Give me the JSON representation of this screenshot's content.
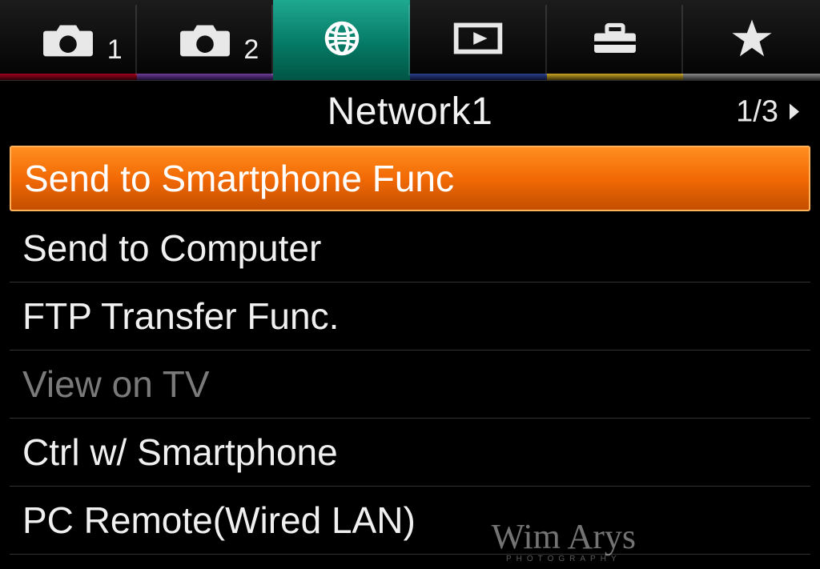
{
  "tabs": [
    {
      "name": "camera-1-tab",
      "icon": "camera-icon",
      "badge": "1",
      "underline": "red",
      "active": false
    },
    {
      "name": "camera-2-tab",
      "icon": "camera-icon",
      "badge": "2",
      "underline": "purple",
      "active": false
    },
    {
      "name": "network-tab",
      "icon": "globe-icon",
      "badge": "",
      "underline": "teal",
      "active": true
    },
    {
      "name": "playback-tab",
      "icon": "playback-icon",
      "badge": "",
      "underline": "blue",
      "active": false
    },
    {
      "name": "setup-tab",
      "icon": "toolbox-icon",
      "badge": "",
      "underline": "yellow",
      "active": false
    },
    {
      "name": "my-menu-tab",
      "icon": "star-icon",
      "badge": "",
      "underline": "gray2",
      "active": false
    }
  ],
  "page": {
    "title": "Network1",
    "index": "1/3"
  },
  "menu": [
    {
      "label": "Send to Smartphone Func",
      "selected": true,
      "disabled": false
    },
    {
      "label": "Send to Computer",
      "selected": false,
      "disabled": false
    },
    {
      "label": "FTP Transfer Func.",
      "selected": false,
      "disabled": false
    },
    {
      "label": "View on TV",
      "selected": false,
      "disabled": true
    },
    {
      "label": "Ctrl w/ Smartphone",
      "selected": false,
      "disabled": false
    },
    {
      "label": "PC Remote(Wired LAN)",
      "selected": false,
      "disabled": false
    }
  ],
  "watermark": {
    "text": "Wim Arys",
    "sub": "PHOTOGRAPHY"
  }
}
